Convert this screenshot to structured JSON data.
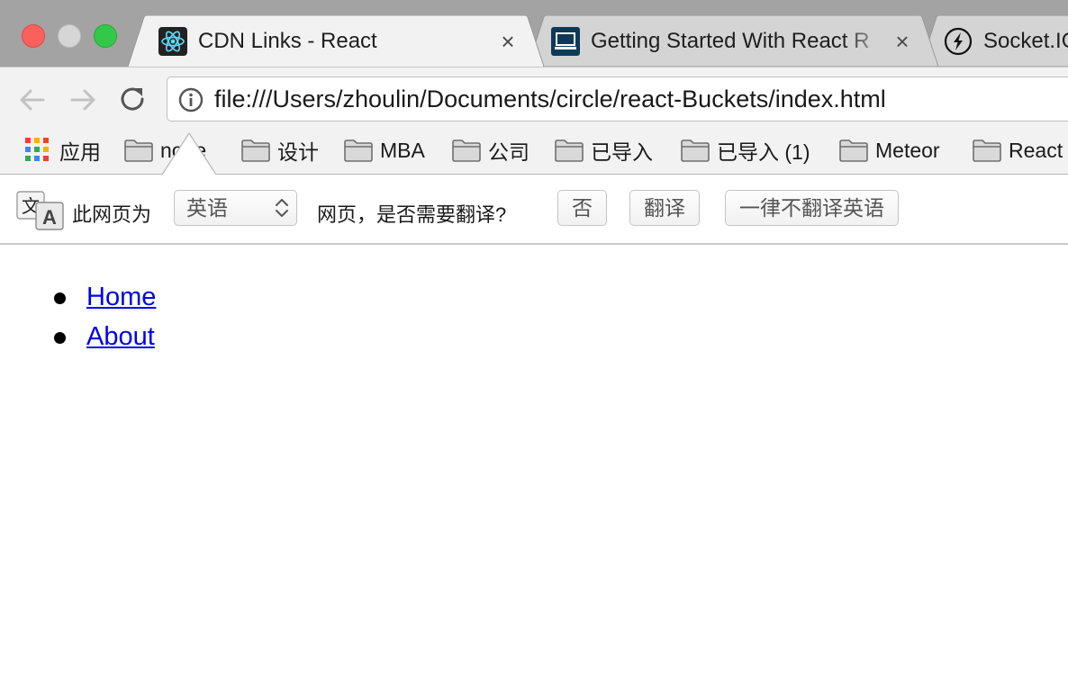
{
  "tabs": [
    {
      "title": "CDN Links - React",
      "favicon": "react-logo-icon",
      "active": true,
      "closable": true
    },
    {
      "title": "Getting Started With React R",
      "favicon": "laptop-logo-icon",
      "active": false,
      "closable": true
    },
    {
      "title": "Socket.IO",
      "favicon": "socketio-logo-icon",
      "active": false,
      "closable": false
    }
  ],
  "toolbar": {
    "url": "file:///Users/zhoulin/Documents/circle/react-Buckets/index.html",
    "back_icon": "back-arrow-icon",
    "forward_icon": "forward-arrow-icon",
    "reload_icon": "reload-icon",
    "info_icon": "info-icon"
  },
  "bookmarks": {
    "apps_label": "应用",
    "items": [
      {
        "label": "node"
      },
      {
        "label": "设计"
      },
      {
        "label": "MBA"
      },
      {
        "label": "公司"
      },
      {
        "label": "已导入"
      },
      {
        "label": "已导入 (1)"
      },
      {
        "label": "Meteor"
      },
      {
        "label": "React"
      }
    ]
  },
  "translate": {
    "prefix": "此网页为",
    "language": "英语",
    "question": "网页，是否需要翻译?",
    "no_label": "否",
    "translate_label": "翻译",
    "never_label": "一律不翻译英语"
  },
  "content": {
    "links": [
      {
        "label": "Home"
      },
      {
        "label": "About"
      }
    ]
  },
  "colors": {
    "link": "#0000ee",
    "close_red": "#fc605b",
    "maximize_green": "#34c84a",
    "react_cyan": "#61dafb"
  }
}
